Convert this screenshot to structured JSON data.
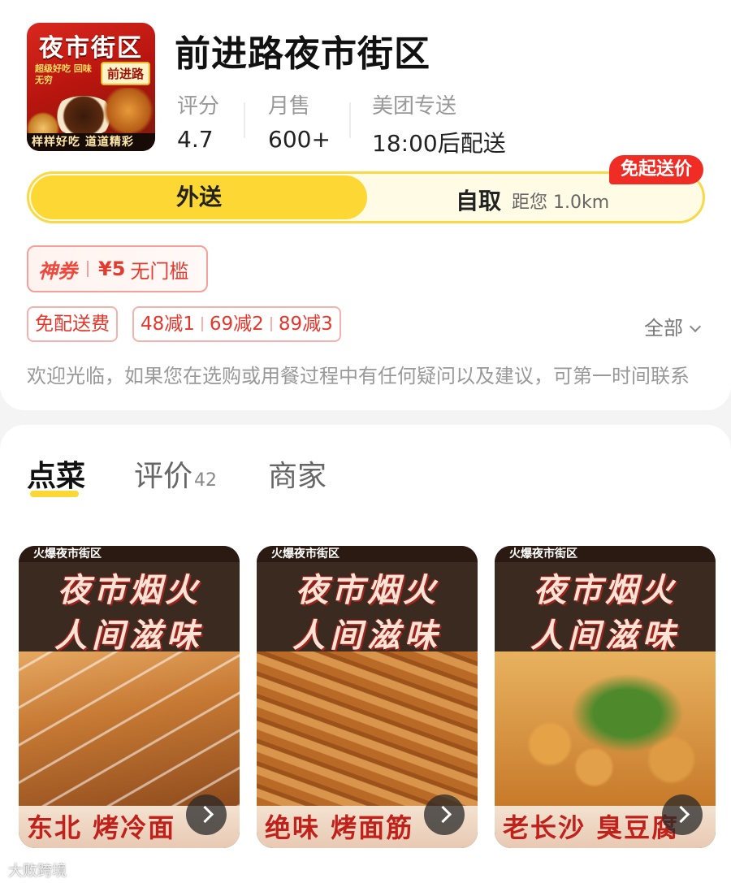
{
  "shop": {
    "name": "前进路夜市街区",
    "logo": {
      "title": "夜市街区",
      "badge": "前进路",
      "slogan": "超级好吃 回味无穷",
      "bottom_text": "样样好吃 道道精彩"
    }
  },
  "stats": [
    {
      "label": "评分",
      "value": "4.7"
    },
    {
      "label": "月售",
      "value": "600+"
    },
    {
      "label": "美团专送",
      "value": "18:00后配送"
    }
  ],
  "mode": {
    "delivery_label": "外送",
    "pickup_label": "自取",
    "distance": "距您 1.0km",
    "free_start_tag": "免起送价"
  },
  "coupon": {
    "name": "神券",
    "amount": "¥5",
    "rule": "无门槛"
  },
  "promos": {
    "free_delivery": "免配送费",
    "discounts": [
      "48减1",
      "69减2",
      "89减3"
    ],
    "all_label": "全部"
  },
  "notice": "欢迎光临，如果您在选购或用餐过程中有任何疑问以及建议，可第一时间联系",
  "tabs": [
    {
      "label": "点菜",
      "count": ""
    },
    {
      "label": "评价",
      "count": "42"
    },
    {
      "label": "商家",
      "count": ""
    }
  ],
  "foods": [
    {
      "top_band": "火爆夜市街区",
      "headline_1": "夜市烟火",
      "headline_2": "人间滋味",
      "caption": "东北 烤冷面"
    },
    {
      "top_band": "火爆夜市街区",
      "headline_1": "夜市烟火",
      "headline_2": "人间滋味",
      "caption": "绝味 烤面筋"
    },
    {
      "top_band": "火爆夜市街区",
      "headline_1": "夜市烟火",
      "headline_2": "人间滋味",
      "caption": "老长沙 臭豆腐"
    }
  ],
  "watermark": "大败跨境",
  "colors": {
    "accent_yellow": "#fdd835",
    "accent_red": "#f02d25"
  }
}
